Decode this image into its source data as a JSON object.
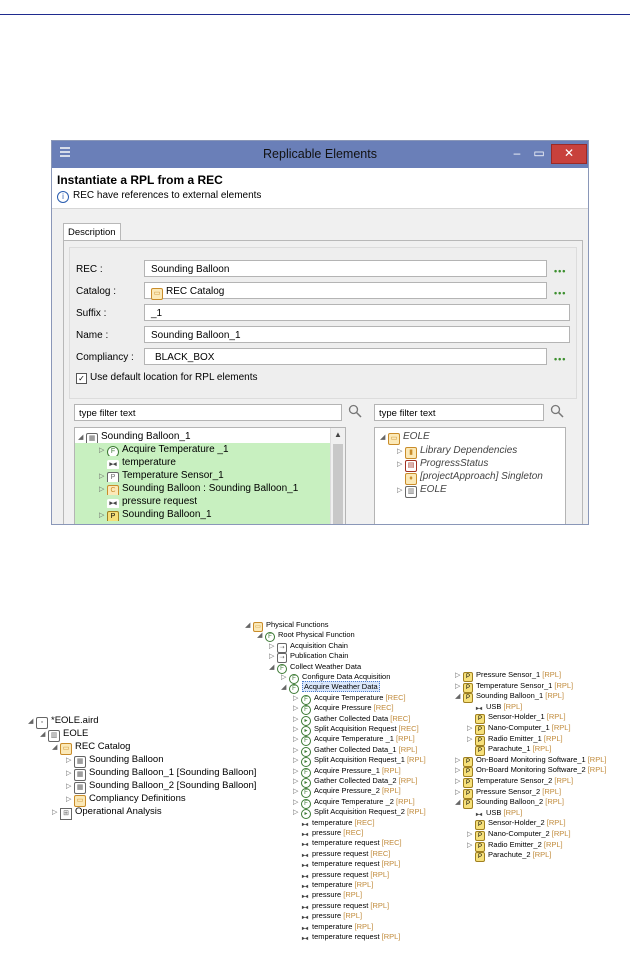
{
  "dialog": {
    "title": "Replicable Elements",
    "heading": "Instantiate a RPL from a REC",
    "info": "REC have references to external elements",
    "window_min": "–",
    "window_max": "▭",
    "window_close": "✕",
    "tab": "Description",
    "fields": [
      {
        "label": "REC :",
        "value": "Sounding Balloon"
      },
      {
        "label": "Catalog :",
        "value": "REC Catalog"
      },
      {
        "label": "Suffix :",
        "value": "_1"
      },
      {
        "label": "Name :",
        "value": "Sounding Balloon_1"
      },
      {
        "label": "Compliancy :",
        "value": "BLACK_BOX"
      }
    ],
    "browse": "•••",
    "checkbox_label": "Use default location for RPL elements",
    "checkbox_checked": true,
    "filter_left": "type filter text",
    "filter_right": "type filter text",
    "left_tree": [
      "Sounding Balloon_1",
      "Acquire Temperature _1",
      "temperature",
      "Temperature Sensor_1",
      "Sounding Balloon : Sounding Balloon_1",
      "pressure request",
      "Sounding Balloon_1"
    ],
    "right_tree": [
      "EOLE",
      "Library Dependencies",
      "ProgressStatus",
      "[projectApproach] Singleton",
      "EOLE"
    ]
  },
  "left_model_tree": [
    "*EOLE.aird",
    "EOLE",
    "REC Catalog",
    "Sounding Balloon",
    "Sounding Balloon_1 [Sounding Balloon]",
    "Sounding Balloon_2 [Sounding Balloon]",
    "Compliancy Definitions",
    "Operational Analysis"
  ],
  "middle_tree": {
    "nodes": [
      {
        "label": "Physical Functions",
        "tag": ""
      },
      {
        "label": "Root Physical Function",
        "tag": ""
      },
      {
        "label": "Acquisition Chain",
        "tag": ""
      },
      {
        "label": "Publication Chain",
        "tag": ""
      },
      {
        "label": "Collect Weather Data",
        "tag": ""
      },
      {
        "label": "Configure Data Acquisition",
        "tag": ""
      },
      {
        "label": "Acquire Weather Data",
        "tag": ""
      },
      {
        "label": "Acquire Temperature",
        "tag": "[REC]"
      },
      {
        "label": "Acquire Pressure",
        "tag": "[REC]"
      },
      {
        "label": "Gather Collected Data",
        "tag": "[REC]"
      },
      {
        "label": "Split Acquisition Request",
        "tag": "[REC]"
      },
      {
        "label": "Acquire Temperature _1",
        "tag": "[RPL]"
      },
      {
        "label": "Gather Collected Data_1",
        "tag": "[RPL]"
      },
      {
        "label": "Split Acquisition Request_1",
        "tag": "[RPL]"
      },
      {
        "label": "Acquire Pressure_1",
        "tag": "[RPL]"
      },
      {
        "label": "Gather Collected Data_2",
        "tag": "[RPL]"
      },
      {
        "label": "Acquire Pressure_2",
        "tag": "[RPL]"
      },
      {
        "label": "Acquire Temperature _2",
        "tag": "[RPL]"
      },
      {
        "label": "Split Acquisition Request_2",
        "tag": "[RPL]"
      },
      {
        "label": "temperature",
        "tag": "[REC]"
      },
      {
        "label": "pressure",
        "tag": "[REC]"
      },
      {
        "label": "temperature request",
        "tag": "[REC]"
      },
      {
        "label": "pressure request",
        "tag": "[REC]"
      },
      {
        "label": "temperature request",
        "tag": "[RPL]"
      },
      {
        "label": "pressure request",
        "tag": "[RPL]"
      },
      {
        "label": "temperature",
        "tag": "[RPL]"
      },
      {
        "label": "pressure",
        "tag": "[RPL]"
      },
      {
        "label": "pressure request",
        "tag": "[RPL]"
      },
      {
        "label": "pressure",
        "tag": "[RPL]"
      },
      {
        "label": "temperature",
        "tag": "[RPL]"
      },
      {
        "label": "temperature request",
        "tag": "[RPL]"
      }
    ]
  },
  "right_tree": {
    "nodes": [
      {
        "label": "Pressure Sensor_1",
        "tag": "[RPL]"
      },
      {
        "label": "Temperature Sensor_1",
        "tag": "[RPL]"
      },
      {
        "label": "Sounding Balloon_1",
        "tag": "[RPL]"
      },
      {
        "label": "USB",
        "tag": "[RPL]"
      },
      {
        "label": "Sensor-Holder_1",
        "tag": "[RPL]"
      },
      {
        "label": "Nano-Computer_1",
        "tag": "[RPL]"
      },
      {
        "label": "Radio Emitter_1",
        "tag": "[RPL]"
      },
      {
        "label": "Parachute_1",
        "tag": "[RPL]"
      },
      {
        "label": "On-Board Monitoring Software_1",
        "tag": "[RPL]"
      },
      {
        "label": "On-Board Monitoring Software_2",
        "tag": "[RPL]"
      },
      {
        "label": "Temperature Sensor_2",
        "tag": "[RPL]"
      },
      {
        "label": "Pressure Sensor_2",
        "tag": "[RPL]"
      },
      {
        "label": "Sounding Balloon_2",
        "tag": "[RPL]"
      },
      {
        "label": "USB",
        "tag": "[RPL]"
      },
      {
        "label": "Sensor-Holder_2",
        "tag": "[RPL]"
      },
      {
        "label": "Nano-Computer_2",
        "tag": "[RPL]"
      },
      {
        "label": "Radio Emitter_2",
        "tag": "[RPL]"
      },
      {
        "label": "Parachute_2",
        "tag": "[RPL]"
      }
    ]
  }
}
